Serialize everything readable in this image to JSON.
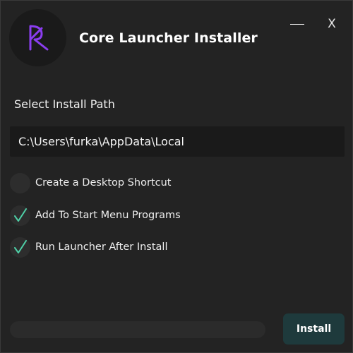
{
  "window": {
    "title": "Core Launcher Installer",
    "minimize_icon": "minimize-icon",
    "close_label": "X"
  },
  "logo": {
    "icon": "core-launcher-logo",
    "color": "#8b3df0"
  },
  "install_path": {
    "label": "Select Install Path",
    "value": "C:\\Users\\furka\\AppData\\Local"
  },
  "options": [
    {
      "label": "Create a Desktop Shortcut",
      "checked": false
    },
    {
      "label": "Add To Start Menu Programs",
      "checked": true
    },
    {
      "label": "Run Launcher After Install",
      "checked": true
    }
  ],
  "progress": {
    "value": 0
  },
  "install_button": {
    "label": "Install"
  },
  "colors": {
    "background": "#232323",
    "field": "#1a1a1a",
    "check_accent": "#4fd1a8",
    "install_button": "#1e3a3c"
  }
}
